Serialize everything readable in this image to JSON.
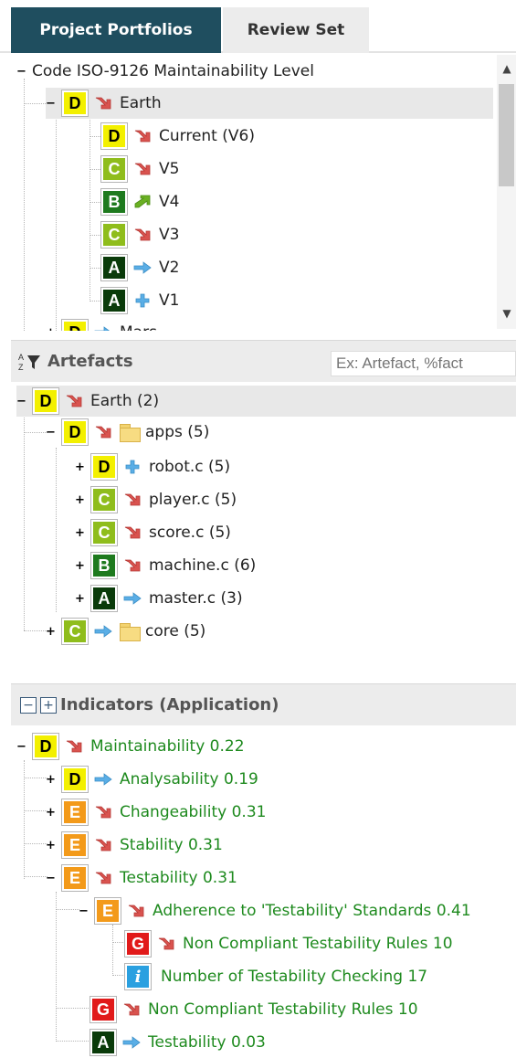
{
  "tabs": [
    {
      "label": "Project Portfolios",
      "active": true
    },
    {
      "label": "Review Set",
      "active": false
    }
  ],
  "portfolio_tree": {
    "root": "Code ISO-9126 Maintainability Level",
    "earth": {
      "grade": "D",
      "trend": "down",
      "label": "Earth"
    },
    "versions": [
      {
        "grade": "D",
        "trend": "down",
        "label": "Current (V6)"
      },
      {
        "grade": "C",
        "trend": "down",
        "label": "V5"
      },
      {
        "grade": "B",
        "trend": "up",
        "label": "V4"
      },
      {
        "grade": "C",
        "trend": "down",
        "label": "V3"
      },
      {
        "grade": "A",
        "trend": "flat",
        "label": "V2"
      },
      {
        "grade": "A",
        "trend": "new",
        "label": "V1"
      }
    ],
    "next": {
      "grade": "D",
      "trend": "flat",
      "label": "Mars"
    }
  },
  "artefacts": {
    "title": "Artefacts",
    "search_placeholder": "Ex: Artefact, %fact",
    "root": {
      "grade": "D",
      "trend": "down",
      "label": "Earth (2)"
    },
    "apps": {
      "grade": "D",
      "trend": "down",
      "label": "apps (5)"
    },
    "files": [
      {
        "grade": "D",
        "trend": "new",
        "label": "robot.c (5)"
      },
      {
        "grade": "C",
        "trend": "down",
        "label": "player.c (5)"
      },
      {
        "grade": "C",
        "trend": "down",
        "label": "score.c (5)"
      },
      {
        "grade": "B",
        "trend": "down",
        "label": "machine.c (6)"
      },
      {
        "grade": "A",
        "trend": "flat",
        "label": "master.c (3)"
      }
    ],
    "core": {
      "grade": "C",
      "trend": "flat",
      "label": "core (5)"
    }
  },
  "indicators": {
    "title": "Indicators (Application)",
    "collapse_symbol": "−",
    "expand_symbol": "+",
    "root": {
      "grade": "D",
      "trend": "down",
      "label": "Maintainability 0.22"
    },
    "children": [
      {
        "grade": "D",
        "trend": "flat",
        "label": "Analysability 0.19"
      },
      {
        "grade": "E",
        "trend": "down",
        "label": "Changeability 0.31"
      },
      {
        "grade": "E",
        "trend": "down",
        "label": "Stability 0.31"
      },
      {
        "grade": "E",
        "trend": "down",
        "label": "Testability 0.31"
      }
    ],
    "adherence": {
      "grade": "E",
      "trend": "down",
      "label": "Adherence to 'Testability' Standards 0.41"
    },
    "ncr_inner": {
      "grade": "G",
      "trend": "down",
      "label": "Non Compliant Testability Rules 10"
    },
    "checking": {
      "grade": "i",
      "label": "Number of Testability Checking 17"
    },
    "ncr": {
      "grade": "G",
      "trend": "down",
      "label": "Non Compliant Testability Rules 10"
    },
    "testability_leaf": {
      "grade": "A",
      "trend": "flat",
      "label": "Testability 0.03"
    }
  },
  "colors": {
    "tab_active": "#1f4e5f",
    "grade_A": "#0a3b0a",
    "grade_B": "#1e7a1e",
    "grade_C": "#8fbd1c",
    "grade_D": "#f3f000",
    "grade_E": "#f39a1a",
    "grade_G": "#e11a1a",
    "info": "#2aa0e0",
    "indicator_text": "#1e8a1e",
    "trend_down": "#d9534f",
    "trend_up": "#6ab023",
    "trend_flat": "#5aaee6"
  }
}
